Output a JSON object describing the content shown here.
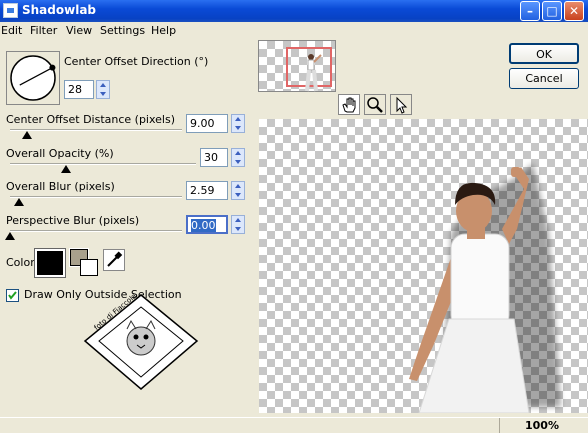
{
  "window": {
    "title": "Shadowlab"
  },
  "menu": [
    "Edit",
    "Filter",
    "View",
    "Settings",
    "Help"
  ],
  "controls": {
    "direction": {
      "label": "Center Offset Direction (°)",
      "value": "28"
    },
    "distance": {
      "label": "Center Offset Distance (pixels)",
      "value": "9.00",
      "fraction": 0.1
    },
    "opacity": {
      "label": "Overall Opacity (%)",
      "value": "30",
      "fraction": 0.3
    },
    "blur": {
      "label": "Overall Blur (pixels)",
      "value": "2.59",
      "fraction": 0.05
    },
    "perspective": {
      "label": "Perspective Blur (pixels)",
      "value": "0.00",
      "fraction": 0.0
    },
    "color_label": "Color",
    "color_value": "#000000",
    "checkbox": {
      "label": "Draw Only Outside Selection",
      "checked": true
    }
  },
  "buttons": {
    "ok": "OK",
    "cancel": "Cancel"
  },
  "watermark": {
    "text": "foto di Fiaccola"
  },
  "status": {
    "zoom": "100%"
  },
  "icons": [
    "hand-icon",
    "zoom-icon",
    "arrow-icon",
    "eyedropper-icon",
    "checkmark-icon"
  ]
}
